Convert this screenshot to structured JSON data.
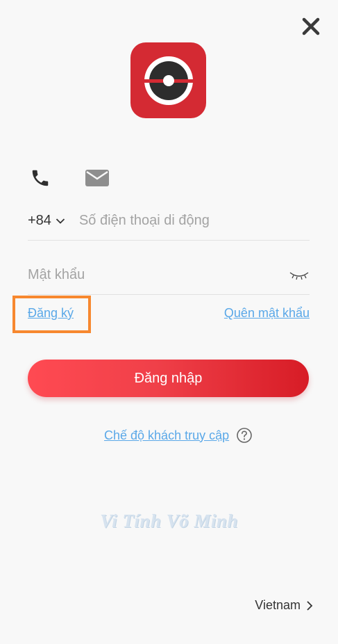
{
  "login": {
    "country_code": "+84",
    "phone_placeholder": "Số điện thoại di động",
    "password_placeholder": "Mật khẩu",
    "register_label": "Đăng ký",
    "forgot_label": "Quên mật khẩu",
    "submit_label": "Đăng nhập",
    "guest_label": "Chế độ khách truy cập"
  },
  "watermark": "Vi Tính Võ Minh",
  "region": {
    "label": "Vietnam"
  },
  "icons": [
    "close-icon",
    "app-logo",
    "phone-icon",
    "email-icon",
    "chevron-down-icon",
    "eye-closed-icon",
    "help-icon",
    "chevron-right-icon"
  ],
  "colors": {
    "accent": "#e83039",
    "link": "#5aa8e8",
    "highlight": "#f7882f",
    "background": "#f8f8f8"
  }
}
